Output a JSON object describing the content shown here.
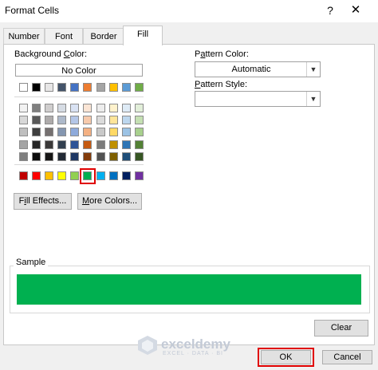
{
  "window": {
    "title": "Format Cells",
    "help": "?",
    "close": "✕"
  },
  "tabs": [
    {
      "label": "Number"
    },
    {
      "label": "Font"
    },
    {
      "label": "Border"
    },
    {
      "label": "Fill",
      "active": true
    }
  ],
  "background_color": {
    "label_pre": "Background ",
    "label_key": "C",
    "label_post": "olor:",
    "no_color": "No Color",
    "rows": [
      [
        "#ffffff",
        "#000000",
        "#e7e6e6",
        "#44546a",
        "#4472c4",
        "#ed7d31",
        "#a5a5a5",
        "#ffc000",
        "#5b9bd5",
        "#70ad47"
      ],
      [
        "#f2f2f2",
        "#7f7f7f",
        "#d0cece",
        "#d6dce4",
        "#d9e2f3",
        "#fbe5d5",
        "#ededed",
        "#fff2cc",
        "#deebf6",
        "#e2efd9"
      ],
      [
        "#d8d8d8",
        "#595959",
        "#aeabab",
        "#adb9ca",
        "#b4c6e7",
        "#f7caac",
        "#dbdbdb",
        "#fee599",
        "#bdd7ee",
        "#c5e0b3"
      ],
      [
        "#bfbfbf",
        "#3f3f3f",
        "#757070",
        "#8496b0",
        "#8eaadb",
        "#f4b183",
        "#c9c9c9",
        "#ffd965",
        "#9cc3e5",
        "#a8d08d"
      ],
      [
        "#a5a5a5",
        "#262626",
        "#3a3838",
        "#323f4f",
        "#2f5496",
        "#c55a11",
        "#7b7b7b",
        "#bf9000",
        "#2e75b5",
        "#538135"
      ],
      [
        "#7f7f7f",
        "#0c0c0c",
        "#171616",
        "#222a35",
        "#1f3864",
        "#833c0b",
        "#525252",
        "#7f6000",
        "#1e4e79",
        "#375623"
      ],
      [
        "#c00000",
        "#ff0000",
        "#ffc000",
        "#ffff00",
        "#92d050",
        "#00b050",
        "#00b0f0",
        "#0070c0",
        "#002060",
        "#7030a0"
      ]
    ],
    "selected_color": "#00b050"
  },
  "buttons": {
    "fill_effects": {
      "pre": "F",
      "key": "i",
      "post": "ll Effects..."
    },
    "more_colors": {
      "pre": "",
      "key": "M",
      "post": "ore Colors..."
    },
    "clear": "Clear",
    "ok": "OK",
    "cancel": "Cancel"
  },
  "pattern_color": {
    "label_pre": "P",
    "label_key": "a",
    "label_post": "ttern Color:",
    "value": "Automatic"
  },
  "pattern_style": {
    "label_pre": "",
    "label_key": "P",
    "label_post": "attern Style:",
    "value": ""
  },
  "sample": {
    "label": "Sample",
    "color": "#00b050"
  },
  "watermark": {
    "name": "exceldemy",
    "tagline": "EXCEL · DATA · BI"
  }
}
